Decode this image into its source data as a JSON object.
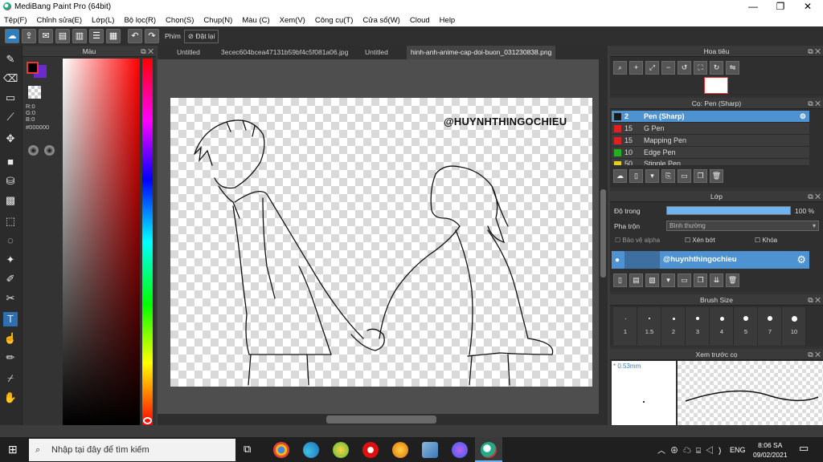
{
  "window": {
    "title": "MediBang Paint Pro (64bit)",
    "min": "—",
    "max": "❐",
    "close": "✕"
  },
  "menu": [
    "Tệp(F)",
    "Chỉnh sửa(E)",
    "Lớp(L)",
    "Bộ lọc(R)",
    "Chọn(S)",
    "Chụp(N)",
    "Màu (C)",
    "Xem(V)",
    "Công cụ(T)",
    "Cửa sổ(W)",
    "Cloud",
    "Help"
  ],
  "toolbar": {
    "label": "Phím",
    "reset": "Đặt lại"
  },
  "color_panel": {
    "title": "Màu",
    "r": "R:0",
    "g": "G:0",
    "b": "B:0",
    "hex": "#000000"
  },
  "tabs": [
    "Untitled",
    "3ecec604bcea47131b59bf4c5f081a06.jpg",
    "Untitled",
    "hinh-anh-anime-cap-doi-buon_031230838.png"
  ],
  "canvas": {
    "watermark": "@HUYNHTHINGOCHIEU"
  },
  "navigator": {
    "title": "Hoa tiêu"
  },
  "brush_panel": {
    "title": "Cọ: Pen (Sharp)",
    "brushes": [
      {
        "size": "2",
        "name": "Pen (Sharp)",
        "color": "#1a1a1a",
        "selected": true
      },
      {
        "size": "15",
        "name": "G Pen",
        "color": "#e02020"
      },
      {
        "size": "15",
        "name": "Mapping Pen",
        "color": "#e02020"
      },
      {
        "size": "10",
        "name": "Edge Pen",
        "color": "#20b020"
      },
      {
        "size": "50",
        "name": "Stipple Pen",
        "color": "#e0d020"
      }
    ]
  },
  "layer_panel": {
    "title": "Lớp",
    "opacity_label": "Độ trong",
    "opacity_value": "100 %",
    "blend_label": "Pha trộn",
    "blend_value": "Bình thường",
    "alpha_label": "Bảo vệ alpha",
    "clip_label": "Xén bớt",
    "lock_label": "Khóa",
    "layer_name": "@huynhthingochieu",
    "opacity_fraction": 1.0
  },
  "brushsize_panel": {
    "title": "Brush Size",
    "sizes": [
      "1",
      "1.5",
      "2",
      "3",
      "4",
      "5",
      "7",
      "10"
    ]
  },
  "preview_panel": {
    "title": "Xem trước cọ",
    "size": "* 0.53mm"
  },
  "taskbar": {
    "search_placeholder": "Nhập tại đây để tìm kiếm",
    "lang": "ENG",
    "time": "8:06 SA",
    "date": "09/02/2021"
  },
  "colors": {
    "accent": "#4e92d2",
    "primary": "#000000",
    "secondary": "#6a2ad0"
  }
}
